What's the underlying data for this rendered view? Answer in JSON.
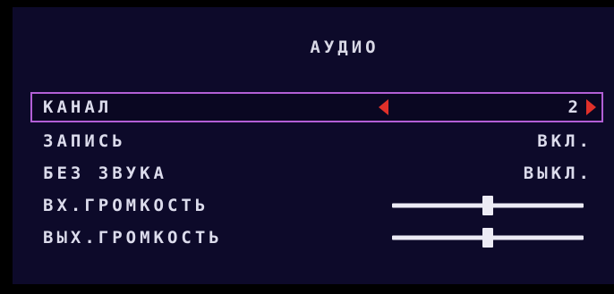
{
  "menu": {
    "title": "АУДИО",
    "items": [
      {
        "label": "КАНАЛ",
        "value": "2",
        "selected": true
      },
      {
        "label": "ЗАПИСЬ",
        "value": "ВКЛ."
      },
      {
        "label": "БЕЗ ЗВУКА",
        "value": "ВЫКЛ."
      },
      {
        "label": "ВХ.ГРОМКОСТЬ",
        "level": 0.5
      },
      {
        "label": "ВЫХ.ГРОМКОСТЬ",
        "level": 0.5
      }
    ]
  },
  "colors": {
    "background": "#0d0a2a",
    "selection_border": "#b25fd6",
    "arrow": "#e0302a",
    "text": "#dcdcec"
  },
  "icons": {
    "left_arrow": "triangle-left-icon",
    "right_arrow": "triangle-right-icon"
  }
}
